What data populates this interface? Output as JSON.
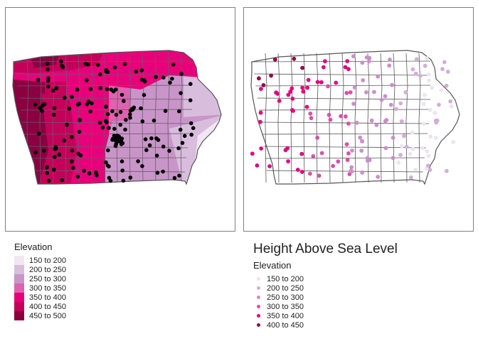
{
  "maps": [
    {
      "id": "left",
      "type": "choropleth-with-points",
      "fill_scale": "pink-purple",
      "points_color": "#000000"
    },
    {
      "id": "right",
      "type": "proportional-color-points",
      "title": "Height Above Sea Level"
    }
  ],
  "legend_left": {
    "title": "Elevation",
    "items": [
      {
        "label": "150 to 200",
        "color": "#f1e6f2"
      },
      {
        "label": "200 to 250",
        "color": "#d8bddc"
      },
      {
        "label": "250 to 300",
        "color": "#c995c9"
      },
      {
        "label": "300 to 350",
        "color": "#dc63b0"
      },
      {
        "label": "350 to 400",
        "color": "#e8007a"
      },
      {
        "label": "400 to 450",
        "color": "#c4005a"
      },
      {
        "label": "450 to 500",
        "color": "#8a0041"
      }
    ]
  },
  "legend_right": {
    "title": "Height Above Sea Level",
    "subtitle": "Elevation",
    "items": [
      {
        "label": "150 to 200",
        "color": "#ece4f0"
      },
      {
        "label": "200 to 250",
        "color": "#d0b0d5"
      },
      {
        "label": "250 to 300",
        "color": "#c98fc8"
      },
      {
        "label": "300 to 350",
        "color": "#dc4fa6"
      },
      {
        "label": "350 to 400",
        "color": "#e6007a"
      },
      {
        "label": "400 to 450",
        "color": "#980043"
      }
    ]
  }
}
